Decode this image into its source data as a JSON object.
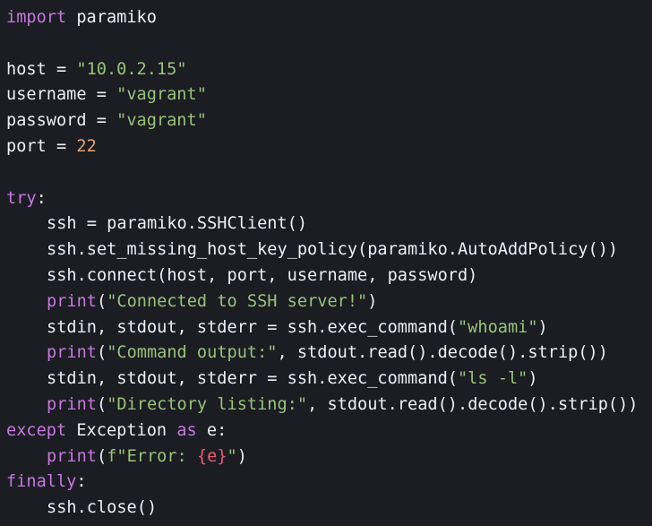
{
  "colors": {
    "background": "#1b1d23",
    "default_text": "#eceff4",
    "keyword": "#c678dd",
    "string": "#98c379",
    "number": "#e5a46b",
    "interpolation": "#ef596f"
  },
  "lines": [
    {
      "indent": 0,
      "tokens": [
        {
          "t": "import",
          "c": "kw"
        },
        {
          "t": " paramiko",
          "c": "plain"
        }
      ]
    },
    {
      "indent": 0,
      "tokens": []
    },
    {
      "indent": 0,
      "tokens": [
        {
          "t": "host = ",
          "c": "plain"
        },
        {
          "t": "\"10.0.2.15\"",
          "c": "str"
        }
      ]
    },
    {
      "indent": 0,
      "tokens": [
        {
          "t": "username = ",
          "c": "plain"
        },
        {
          "t": "\"vagrant\"",
          "c": "str"
        }
      ]
    },
    {
      "indent": 0,
      "tokens": [
        {
          "t": "password = ",
          "c": "plain"
        },
        {
          "t": "\"vagrant\"",
          "c": "str"
        }
      ]
    },
    {
      "indent": 0,
      "tokens": [
        {
          "t": "port = ",
          "c": "plain"
        },
        {
          "t": "22",
          "c": "num"
        }
      ]
    },
    {
      "indent": 0,
      "tokens": []
    },
    {
      "indent": 0,
      "tokens": [
        {
          "t": "try",
          "c": "kw"
        },
        {
          "t": ":",
          "c": "plain"
        }
      ]
    },
    {
      "indent": 1,
      "tokens": [
        {
          "t": "ssh = paramiko.SSHClient()",
          "c": "plain"
        }
      ]
    },
    {
      "indent": 1,
      "tokens": [
        {
          "t": "ssh.set_missing_host_key_policy(paramiko.AutoAddPolicy())",
          "c": "plain"
        }
      ]
    },
    {
      "indent": 1,
      "tokens": [
        {
          "t": "ssh.connect(host, port, username, password)",
          "c": "plain"
        }
      ]
    },
    {
      "indent": 1,
      "tokens": [
        {
          "t": "print",
          "c": "kw"
        },
        {
          "t": "(",
          "c": "plain"
        },
        {
          "t": "\"Connected to SSH server!\"",
          "c": "str"
        },
        {
          "t": ")",
          "c": "plain"
        }
      ]
    },
    {
      "indent": 1,
      "tokens": [
        {
          "t": "stdin, stdout, stderr = ssh.exec_command(",
          "c": "plain"
        },
        {
          "t": "\"whoami\"",
          "c": "str"
        },
        {
          "t": ")",
          "c": "plain"
        }
      ]
    },
    {
      "indent": 1,
      "tokens": [
        {
          "t": "print",
          "c": "kw"
        },
        {
          "t": "(",
          "c": "plain"
        },
        {
          "t": "\"Command output:\"",
          "c": "str"
        },
        {
          "t": ", stdout.read().decode().strip())",
          "c": "plain"
        }
      ]
    },
    {
      "indent": 1,
      "tokens": [
        {
          "t": "stdin, stdout, stderr = ssh.exec_command(",
          "c": "plain"
        },
        {
          "t": "\"ls -l\"",
          "c": "str"
        },
        {
          "t": ")",
          "c": "plain"
        }
      ]
    },
    {
      "indent": 1,
      "tokens": [
        {
          "t": "print",
          "c": "kw"
        },
        {
          "t": "(",
          "c": "plain"
        },
        {
          "t": "\"Directory listing:\"",
          "c": "str"
        },
        {
          "t": ", stdout.read().decode().strip())",
          "c": "plain"
        }
      ]
    },
    {
      "indent": 0,
      "tokens": [
        {
          "t": "except",
          "c": "kw"
        },
        {
          "t": " Exception ",
          "c": "plain"
        },
        {
          "t": "as",
          "c": "kw"
        },
        {
          "t": " e:",
          "c": "plain"
        }
      ]
    },
    {
      "indent": 1,
      "tokens": [
        {
          "t": "print",
          "c": "kw"
        },
        {
          "t": "(",
          "c": "plain"
        },
        {
          "t": "f\"Error: ",
          "c": "str"
        },
        {
          "t": "{e}",
          "c": "interp"
        },
        {
          "t": "\"",
          "c": "str"
        },
        {
          "t": ")",
          "c": "plain"
        }
      ]
    },
    {
      "indent": 0,
      "tokens": [
        {
          "t": "finally",
          "c": "kw"
        },
        {
          "t": ":",
          "c": "plain"
        }
      ]
    },
    {
      "indent": 1,
      "tokens": [
        {
          "t": "ssh.close()",
          "c": "plain"
        }
      ]
    }
  ]
}
